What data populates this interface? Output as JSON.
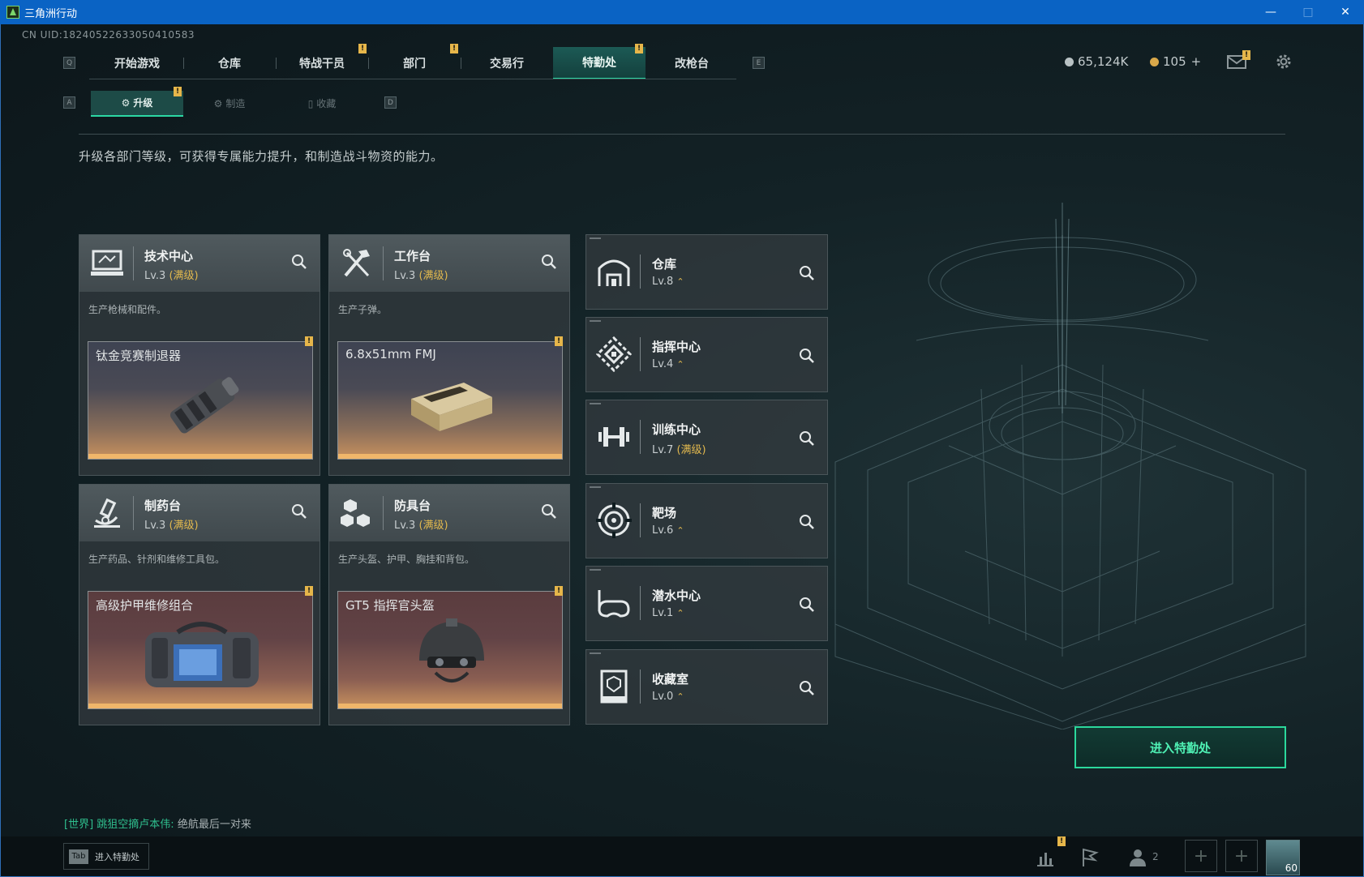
{
  "window": {
    "title": "三角洲行动",
    "controls": [
      "—",
      "□",
      "✕"
    ]
  },
  "uid": "CN UID:18240522633050410583",
  "nav": {
    "key_left": "Q",
    "key_right": "E",
    "tabs": [
      "开始游戏",
      "仓库",
      "特战干员",
      "部门",
      "交易行",
      "特勤处",
      "改枪台"
    ],
    "active": "特勤处"
  },
  "subnav": {
    "key_left": "A",
    "key_right": "D",
    "tabs": [
      "升级",
      "制造",
      "收藏"
    ],
    "active": "升级"
  },
  "currency": {
    "coins": "65,124K",
    "premium": "105",
    "plus": "+"
  },
  "description": "升级各部门等级，可获得专属能力提升，和制造战斗物资的能力。",
  "cards": [
    {
      "name": "技术中心",
      "level": "Lv.3",
      "max": "(满级)",
      "desc": "生产枪械和配件。",
      "item": "钛金竞赛制退器",
      "theme": "gold",
      "icon": "computer-icon"
    },
    {
      "name": "工作台",
      "level": "Lv.3",
      "max": "(满级)",
      "desc": "生产子弹。",
      "item": "6.8x51mm FMJ",
      "theme": "gold",
      "icon": "tools-icon"
    },
    {
      "name": "制药台",
      "level": "Lv.3",
      "max": "(满级)",
      "desc": "生产药品、针剂和维修工具包。",
      "item": "高级护甲维修组合",
      "theme": "red",
      "icon": "microscope-icon"
    },
    {
      "name": "防具台",
      "level": "Lv.3",
      "max": "(满级)",
      "desc": "生产头盔、护甲、胸挂和背包。",
      "item": "GT5 指挥官头盔",
      "theme": "red",
      "icon": "cubes-icon"
    }
  ],
  "departments": [
    {
      "name": "仓库",
      "level": "Lv.8",
      "max": "",
      "upgradable": true,
      "icon": "warehouse-icon"
    },
    {
      "name": "指挥中心",
      "level": "Lv.4",
      "max": "",
      "upgradable": true,
      "icon": "command-icon"
    },
    {
      "name": "训练中心",
      "level": "Lv.7",
      "max": "(满级)",
      "upgradable": false,
      "icon": "dumbbell-icon"
    },
    {
      "name": "靶场",
      "level": "Lv.6",
      "max": "",
      "upgradable": true,
      "icon": "target-icon"
    },
    {
      "name": "潜水中心",
      "level": "Lv.1",
      "max": "",
      "upgradable": true,
      "icon": "diving-mask-icon"
    },
    {
      "name": "收藏室",
      "level": "Lv.0",
      "max": "",
      "upgradable": true,
      "icon": "trophy-case-icon"
    }
  ],
  "enter_button": "进入特勤处",
  "chat": {
    "channel": "[世界]",
    "sender": "跳狙空摘卢本伟:",
    "message": "绝航最后一对来"
  },
  "bottom": {
    "tab_key": "Tab",
    "tab_label": "进入特勤处",
    "friends_count": "2",
    "player_level": "60"
  },
  "colors": {
    "accent": "#2bd8a4",
    "warning": "#e6b64a",
    "max_level": "#e1b84e",
    "titlebar": "#0a63c4"
  }
}
